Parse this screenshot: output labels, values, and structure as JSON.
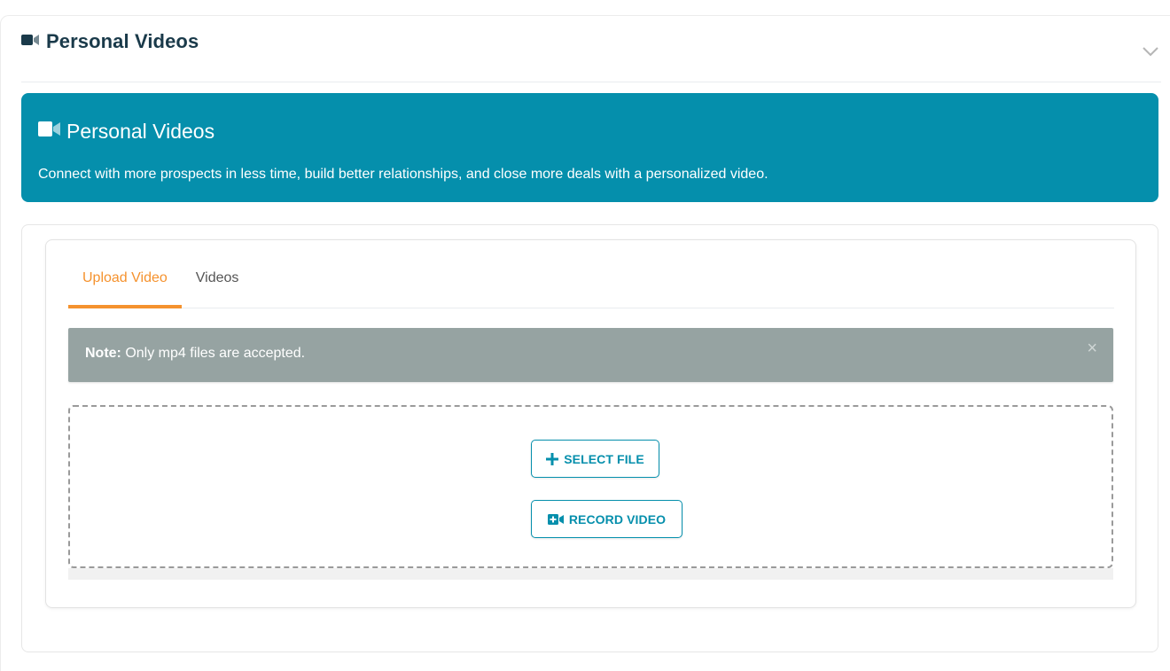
{
  "section": {
    "title": "Personal Videos"
  },
  "banner": {
    "title": "Personal Videos",
    "description": "Connect with more prospects in less time, build better relationships, and close more deals with a personalized video."
  },
  "tabs": [
    {
      "label": "Upload Video",
      "active": true
    },
    {
      "label": "Videos",
      "active": false
    }
  ],
  "alert": {
    "strong": "Note:",
    "text": " Only mp4 files are accepted.",
    "close": "×"
  },
  "buttons": {
    "select_file": "SELECT FILE",
    "record_video": "RECORD VIDEO"
  },
  "icons": {
    "header_camera": "video-camera-icon",
    "banner_camera": "video-camera-icon",
    "chevron": "chevron-down-icon",
    "plus": "plus-icon",
    "record": "video-plus-icon"
  },
  "colors": {
    "brand": "#058fac",
    "accent": "#f5922e",
    "header_text": "#1a3a4a",
    "alert_bg": "#96a3a2"
  }
}
